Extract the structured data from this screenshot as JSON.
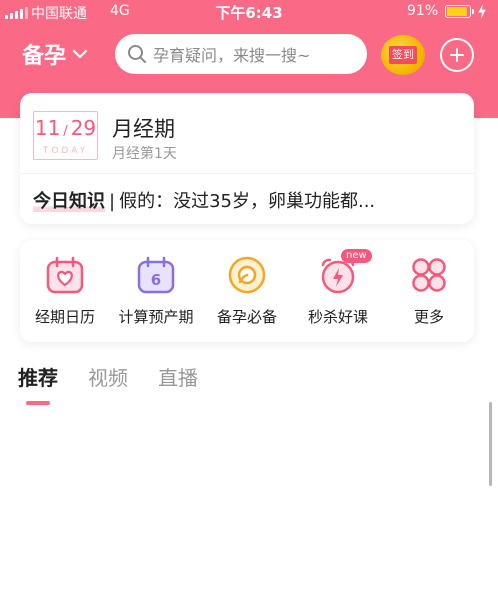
{
  "status_bar": {
    "carrier": "中国联通",
    "network": "4G",
    "time": "下午6:43",
    "battery": "91%",
    "battery_level": 0.91
  },
  "header": {
    "mode": "备孕",
    "search_placeholder": "孕育疑问，来搜一搜~",
    "checkin_label": "签到"
  },
  "period_card": {
    "date": "11",
    "date_sep": "/",
    "date_day": "29",
    "today_label": "TODAY",
    "title": "月经期",
    "subtitle": "月经第1天",
    "knowledge_tag": "今日知识",
    "knowledge_sep": "|",
    "knowledge_text": "假的：没过35岁，卵巢功能都..."
  },
  "shortcuts": [
    {
      "label": "经期日历",
      "icon": "calendar-heart-icon"
    },
    {
      "label": "计算预产期",
      "icon": "calendar-six-icon"
    },
    {
      "label": "备孕必备",
      "icon": "egg-icon"
    },
    {
      "label": "秒杀好课",
      "icon": "alarm-clock-icon",
      "badge": "new"
    },
    {
      "label": "更多",
      "icon": "more-grid-icon"
    }
  ],
  "tabs": [
    {
      "label": "推荐",
      "active": true
    },
    {
      "label": "视频",
      "active": false
    },
    {
      "label": "直播",
      "active": false
    }
  ],
  "colors": {
    "brand": "#fa6a86",
    "accent_pink": "#f4587c",
    "purple": "#8a6ee0",
    "orange": "#f5a623"
  }
}
